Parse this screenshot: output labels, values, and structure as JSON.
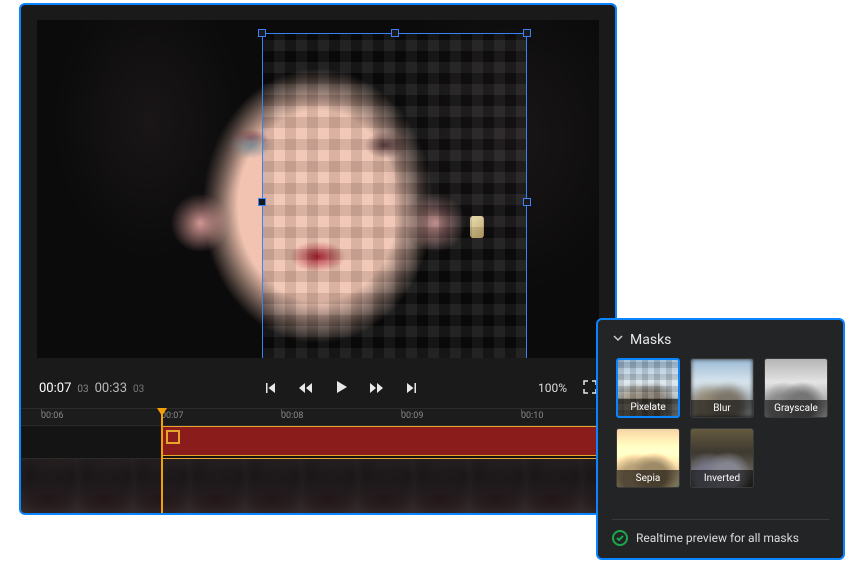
{
  "player": {
    "current_time": "00:07",
    "current_frame": "03",
    "duration": "00:33",
    "duration_frame": "03",
    "zoom_label": "100%"
  },
  "ruler": {
    "ticks": [
      "00:06",
      "00:07",
      "00:08",
      "00:09",
      "00:10"
    ]
  },
  "masks_panel": {
    "title": "Masks",
    "items": [
      {
        "label": "Pixelate"
      },
      {
        "label": "Blur"
      },
      {
        "label": "Grayscale"
      },
      {
        "label": "Sepia"
      },
      {
        "label": "Inverted"
      }
    ],
    "selected_index": 0,
    "realtime_label": "Realtime preview for all masks"
  }
}
